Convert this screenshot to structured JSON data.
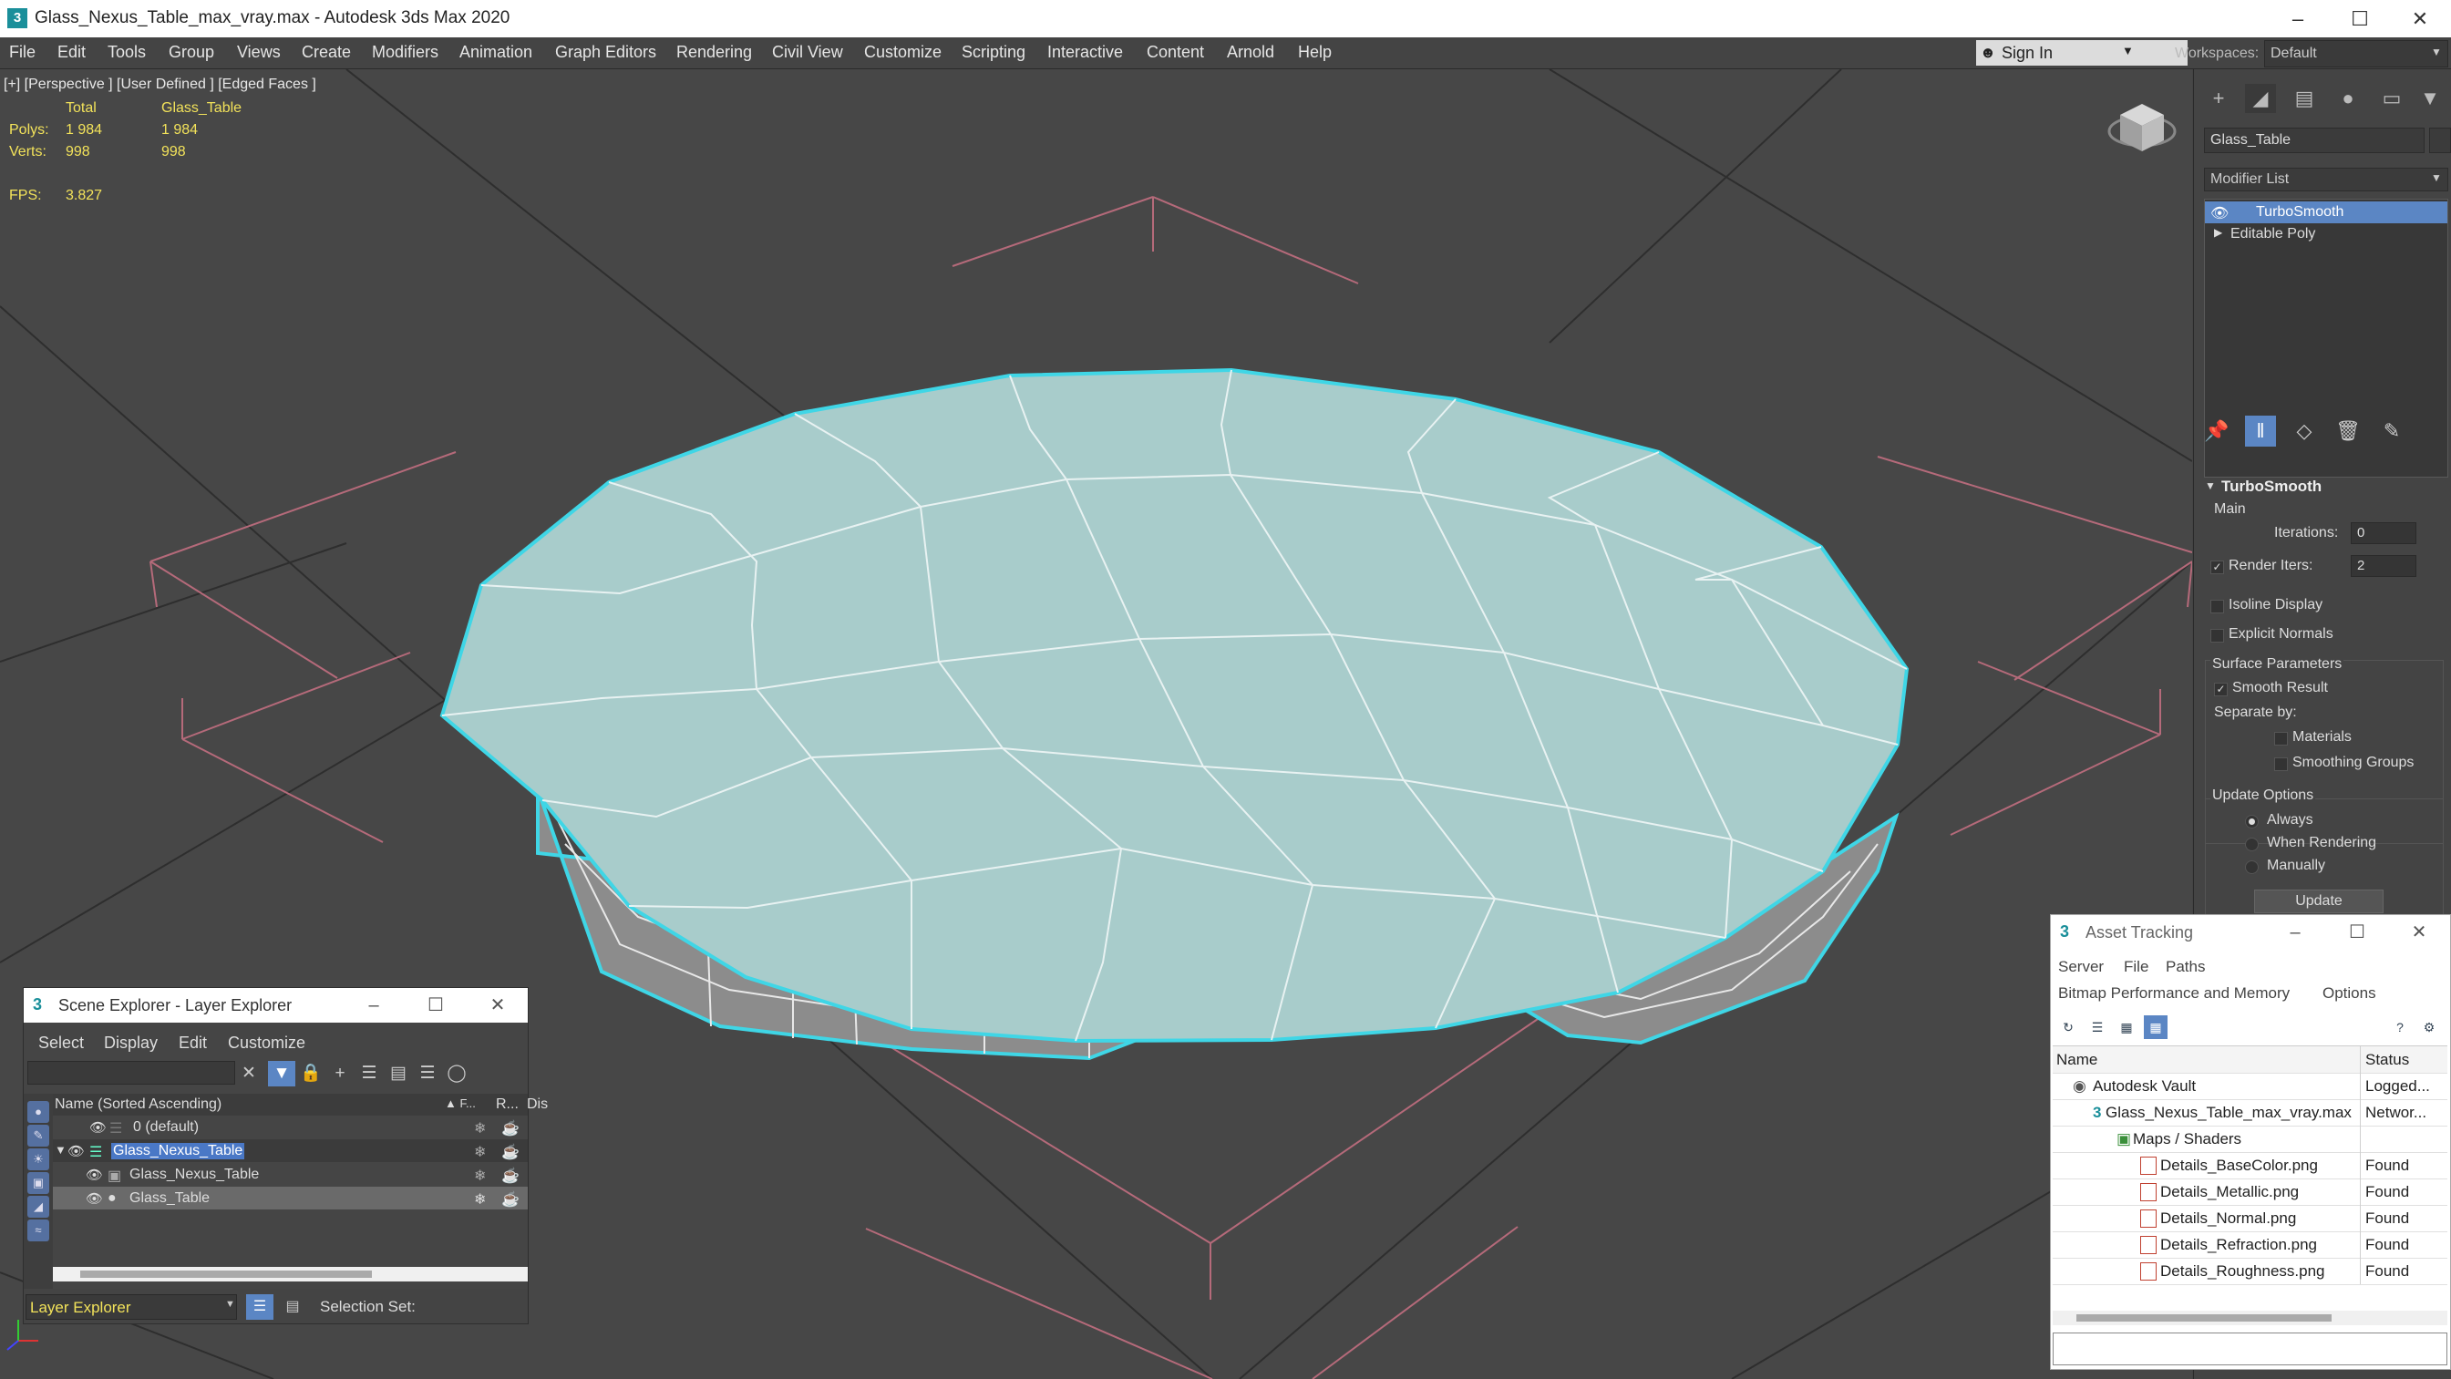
{
  "window": {
    "title": "Glass_Nexus_Table_max_vray.max - Autodesk 3ds Max 2020",
    "app_icon": "3"
  },
  "menu": [
    "File",
    "Edit",
    "Tools",
    "Group",
    "Views",
    "Create",
    "Modifiers",
    "Animation",
    "Graph Editors",
    "Rendering",
    "Civil View",
    "Customize",
    "Scripting",
    "Interactive",
    "Content",
    "Arnold",
    "Help"
  ],
  "signin": {
    "label": "Sign In"
  },
  "workspaces": {
    "label": "Workspaces:",
    "value": "Default"
  },
  "viewport": {
    "label": "[+] [Perspective ] [User Defined ] [Edged Faces ]",
    "stats": {
      "col_total": "Total",
      "col_object": "Glass_Table",
      "polys_label": "Polys:",
      "polys_total": "1 984",
      "polys_object": "1 984",
      "verts_label": "Verts:",
      "verts_total": "998",
      "verts_object": "998",
      "fps_label": "FPS:",
      "fps_value": "3.827"
    }
  },
  "command_panel": {
    "object_name": "Glass_Table",
    "modifier_list": "Modifier List",
    "stack": [
      "TurboSmooth",
      "Editable Poly"
    ],
    "turbosmooth": {
      "title": "TurboSmooth",
      "main": "Main",
      "iterations_label": "Iterations:",
      "iterations_value": "0",
      "render_iters_label": "Render Iters:",
      "render_iters_value": "2",
      "isoline_display": "Isoline Display",
      "explicit_normals": "Explicit Normals",
      "surface_parameters": "Surface Parameters",
      "smooth_result": "Smooth Result",
      "separate_by": "Separate by:",
      "materials": "Materials",
      "smoothing_groups": "Smoothing Groups",
      "update_options": "Update Options",
      "always": "Always",
      "when_rendering": "When Rendering",
      "manually": "Manually",
      "update_button": "Update"
    }
  },
  "scene_explorer": {
    "title": "Scene Explorer - Layer Explorer",
    "menu": [
      "Select",
      "Display",
      "Edit",
      "Customize"
    ],
    "columns": {
      "name": "Name (Sorted Ascending)",
      "frozen": "▲ F...",
      "render": "R...",
      "display": "Dis"
    },
    "rows": [
      "0 (default)",
      "Glass_Nexus_Table",
      "Glass_Nexus_Table",
      "Glass_Table"
    ],
    "bottom_dropdown": "Layer Explorer",
    "selection_set_label": "Selection Set:"
  },
  "asset_tracking": {
    "title": "Asset Tracking",
    "menu": [
      "Server",
      "File",
      "Paths"
    ],
    "menu2": [
      "Bitmap Performance and Memory",
      "Options"
    ],
    "columns": {
      "name": "Name",
      "status": "Status"
    },
    "rows": [
      {
        "name": "Autodesk Vault",
        "status": "Logged..."
      },
      {
        "name": "Glass_Nexus_Table_max_vray.max",
        "status": "Networ..."
      },
      {
        "name": "Maps / Shaders",
        "status": ""
      },
      {
        "name": "Details_BaseColor.png",
        "status": "Found"
      },
      {
        "name": "Details_Metallic.png",
        "status": "Found"
      },
      {
        "name": "Details_Normal.png",
        "status": "Found"
      },
      {
        "name": "Details_Refraction.png",
        "status": "Found"
      },
      {
        "name": "Details_Roughness.png",
        "status": "Found"
      }
    ]
  },
  "colors": {
    "selection_blue": "#5b86c4",
    "stat_yellow": "#f2e25a",
    "table_top": "#a8cccb",
    "outline_cyan": "#3fd6e6"
  }
}
